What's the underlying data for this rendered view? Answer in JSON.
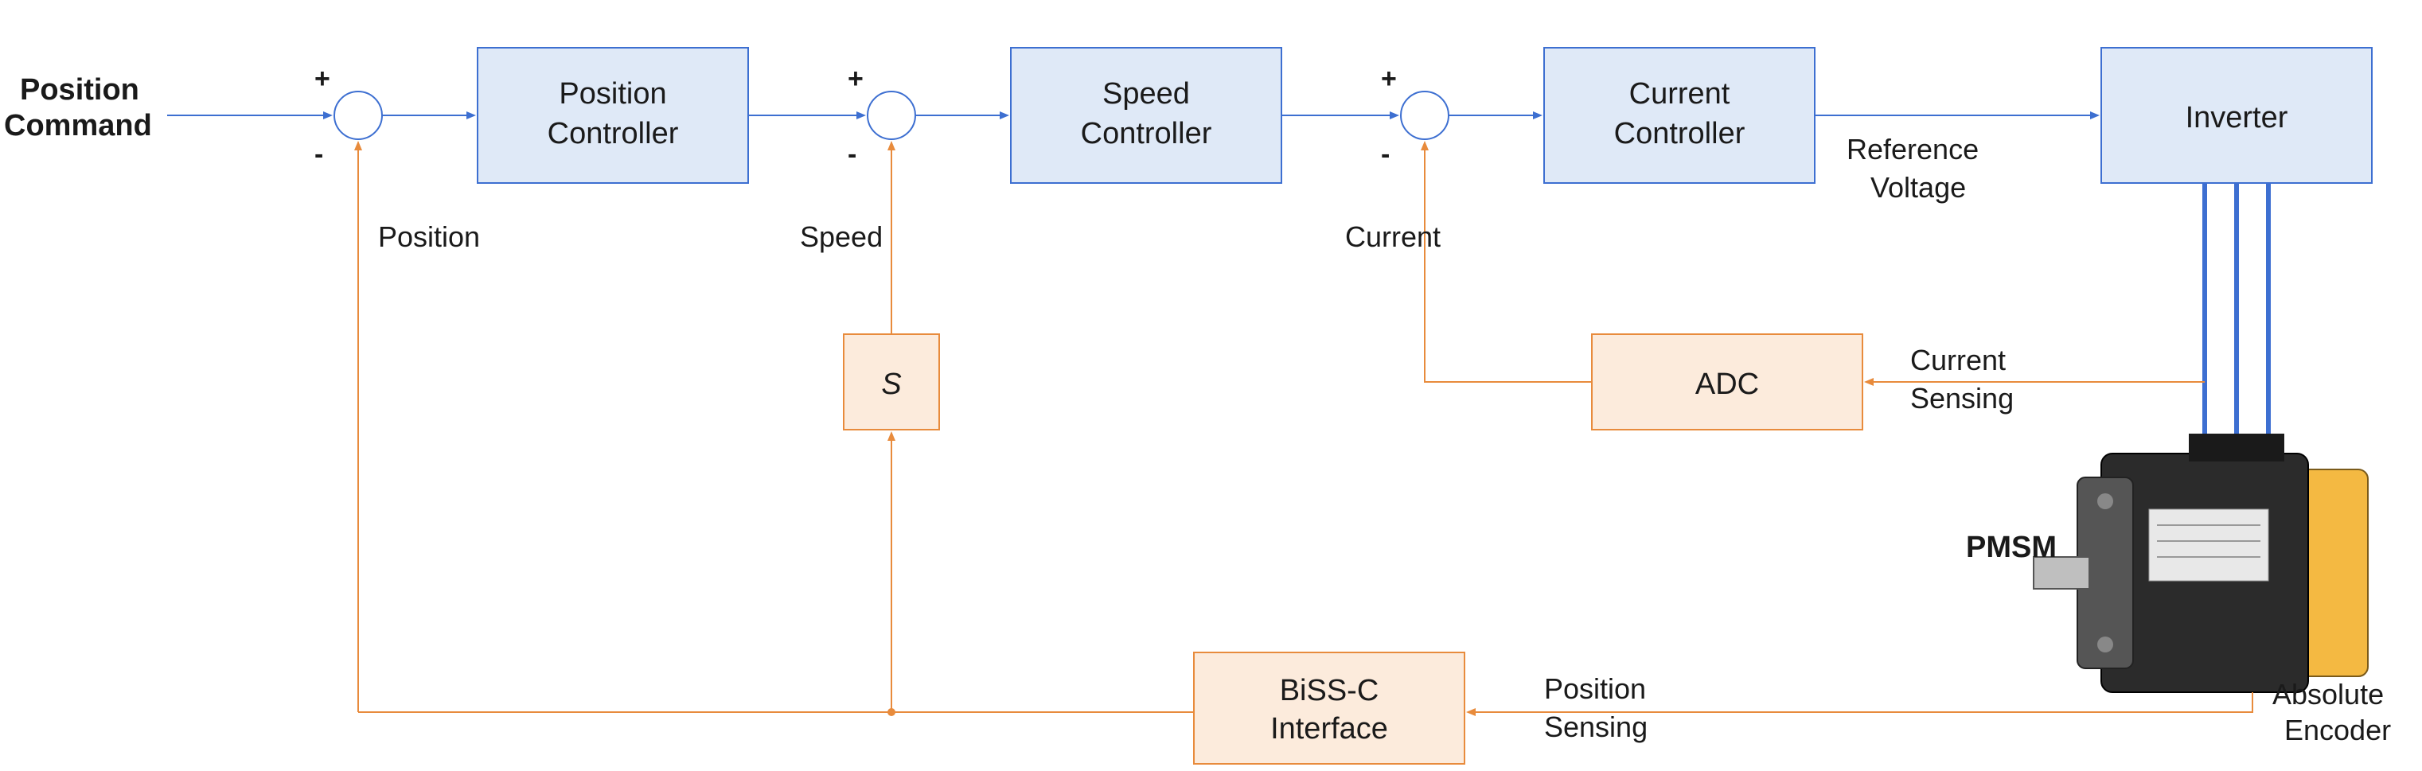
{
  "input": {
    "line1": "Position",
    "line2": "Command"
  },
  "blocks": {
    "position_controller": {
      "line1": "Position",
      "line2": "Controller"
    },
    "speed_controller": {
      "line1": "Speed",
      "line2": "Controller"
    },
    "current_controller": {
      "line1": "Current",
      "line2": "Controller"
    },
    "inverter": {
      "line1": "Inverter"
    },
    "derivative": {
      "symbol": "S"
    },
    "adc": {
      "line1": "ADC"
    },
    "biss": {
      "line1": "BiSS-C",
      "line2": "Interface"
    }
  },
  "labels": {
    "ref_voltage": {
      "line1": "Reference",
      "line2": "Voltage"
    },
    "current_sensing": {
      "line1": "Current",
      "line2": "Sensing"
    },
    "position_sensing": {
      "line1": "Position",
      "line2": "Sensing"
    },
    "absolute_encoder": {
      "line1": "Absolute",
      "line2": "Encoder"
    },
    "pmsm": "PMSM",
    "feedback_position": "Position",
    "feedback_speed": "Speed",
    "feedback_current": "Current"
  },
  "signs": {
    "plus": "+",
    "minus": "-"
  }
}
